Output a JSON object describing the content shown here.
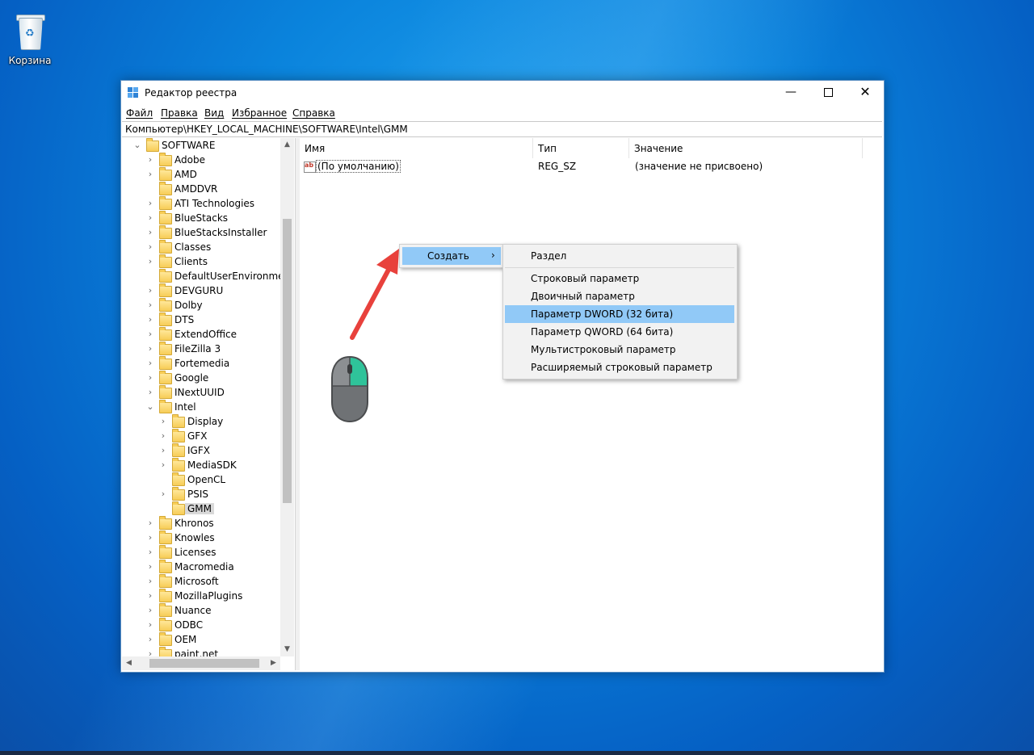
{
  "desktop": {
    "recycle_bin_label": "Корзина"
  },
  "window": {
    "title": "Редактор реестра",
    "controls": {
      "minimize": "—",
      "close": "✕"
    }
  },
  "menu": {
    "file": "Файл",
    "edit": "Правка",
    "view": "Вид",
    "favorites": "Избранное",
    "help": "Справка"
  },
  "address": "Компьютер\\HKEY_LOCAL_MACHINE\\SOFTWARE\\Intel\\GMM",
  "tree": {
    "root": {
      "label": "SOFTWARE",
      "expanded": true
    },
    "items": [
      {
        "label": "Adobe",
        "level": 1,
        "chevron": "›"
      },
      {
        "label": "AMD",
        "level": 1,
        "chevron": "›"
      },
      {
        "label": "AMDDVR",
        "level": 1,
        "chevron": ""
      },
      {
        "label": "ATI Technologies",
        "level": 1,
        "chevron": "›"
      },
      {
        "label": "BlueStacks",
        "level": 1,
        "chevron": "›"
      },
      {
        "label": "BlueStacksInstaller",
        "level": 1,
        "chevron": "›"
      },
      {
        "label": "Classes",
        "level": 1,
        "chevron": "›"
      },
      {
        "label": "Clients",
        "level": 1,
        "chevron": "›"
      },
      {
        "label": "DefaultUserEnvironment",
        "level": 1,
        "chevron": ""
      },
      {
        "label": "DEVGURU",
        "level": 1,
        "chevron": "›"
      },
      {
        "label": "Dolby",
        "level": 1,
        "chevron": "›"
      },
      {
        "label": "DTS",
        "level": 1,
        "chevron": "›"
      },
      {
        "label": "ExtendOffice",
        "level": 1,
        "chevron": "›"
      },
      {
        "label": "FileZilla 3",
        "level": 1,
        "chevron": "›"
      },
      {
        "label": "Fortemedia",
        "level": 1,
        "chevron": "›"
      },
      {
        "label": "Google",
        "level": 1,
        "chevron": "›"
      },
      {
        "label": "INextUUID",
        "level": 1,
        "chevron": "›"
      },
      {
        "label": "Intel",
        "level": 1,
        "chevron": "⌄"
      },
      {
        "label": "Display",
        "level": 2,
        "chevron": "›"
      },
      {
        "label": "GFX",
        "level": 2,
        "chevron": "›"
      },
      {
        "label": "IGFX",
        "level": 2,
        "chevron": "›"
      },
      {
        "label": "MediaSDK",
        "level": 2,
        "chevron": "›"
      },
      {
        "label": "OpenCL",
        "level": 2,
        "chevron": ""
      },
      {
        "label": "PSIS",
        "level": 2,
        "chevron": "›"
      },
      {
        "label": "GMM",
        "level": 2,
        "chevron": "",
        "selected": true
      },
      {
        "label": "Khronos",
        "level": 1,
        "chevron": "›"
      },
      {
        "label": "Knowles",
        "level": 1,
        "chevron": "›"
      },
      {
        "label": "Licenses",
        "level": 1,
        "chevron": "›"
      },
      {
        "label": "Macromedia",
        "level": 1,
        "chevron": "›"
      },
      {
        "label": "Microsoft",
        "level": 1,
        "chevron": "›"
      },
      {
        "label": "MozillaPlugins",
        "level": 1,
        "chevron": "›"
      },
      {
        "label": "Nuance",
        "level": 1,
        "chevron": "›"
      },
      {
        "label": "ODBC",
        "level": 1,
        "chevron": "›"
      },
      {
        "label": "OEM",
        "level": 1,
        "chevron": "›"
      },
      {
        "label": "paint.net",
        "level": 1,
        "chevron": "›"
      }
    ]
  },
  "list": {
    "columns": {
      "name": "Имя",
      "type": "Тип",
      "value": "Значение"
    },
    "rows": [
      {
        "icon": "ab",
        "name": "(По умолчанию)",
        "type": "REG_SZ",
        "value": "(значение не присвоено)"
      }
    ]
  },
  "context_menu": {
    "create_label": "Создать",
    "submenu": {
      "section": "Раздел",
      "items": [
        {
          "label": "Строковый параметр",
          "highlighted": false
        },
        {
          "label": "Двоичный параметр",
          "highlighted": false
        },
        {
          "label": "Параметр DWORD (32 бита)",
          "highlighted": true
        },
        {
          "label": "Параметр QWORD (64 бита)",
          "highlighted": false
        },
        {
          "label": "Мультистроковый параметр",
          "highlighted": false
        },
        {
          "label": "Расширяемый строковый параметр",
          "highlighted": false
        }
      ]
    }
  },
  "colors": {
    "menu_highlight": "#91c9f7",
    "arrow": "#e8413c",
    "mouse_button": "#2fc39a"
  }
}
